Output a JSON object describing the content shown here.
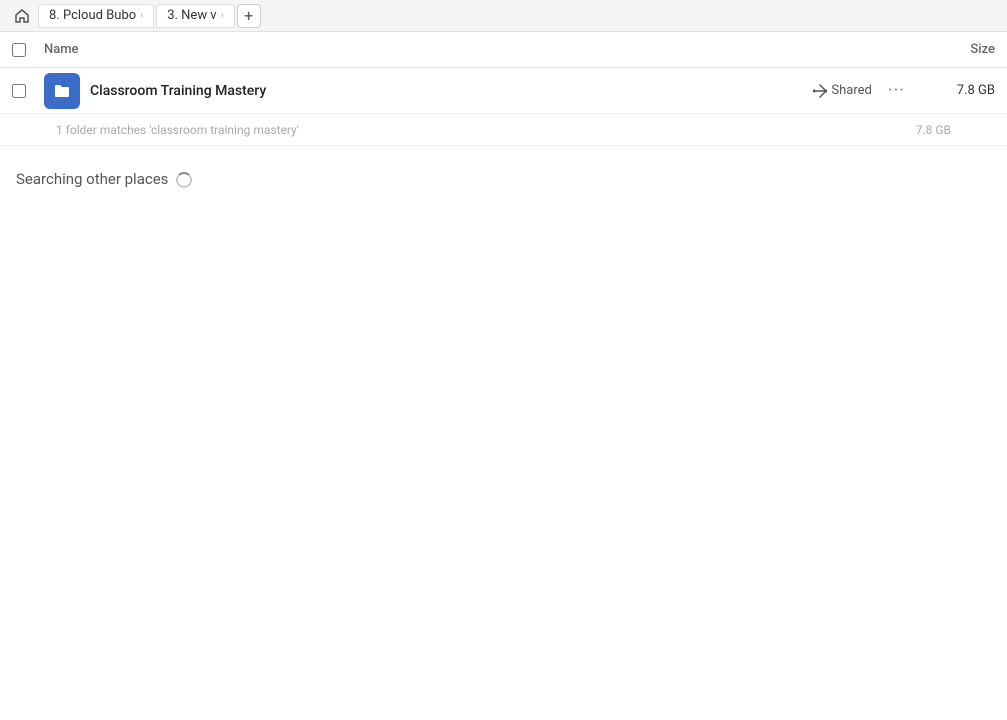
{
  "tabs": {
    "home_icon": "⌂",
    "tab1_label": "8. Pcloud Bubo",
    "tab1_chevron": "›",
    "tab2_label": "3. New v",
    "tab2_chevron": "›",
    "add_label": "+"
  },
  "columns": {
    "name_label": "Name",
    "size_label": "Size"
  },
  "file": {
    "name": "Classroom Training Mastery",
    "shared_label": "Shared",
    "more_label": "···",
    "size": "7.8 GB"
  },
  "match": {
    "text": "1 folder matches 'classroom training mastery'",
    "size": "7.8 GB"
  },
  "searching": {
    "label": "Searching other places"
  }
}
